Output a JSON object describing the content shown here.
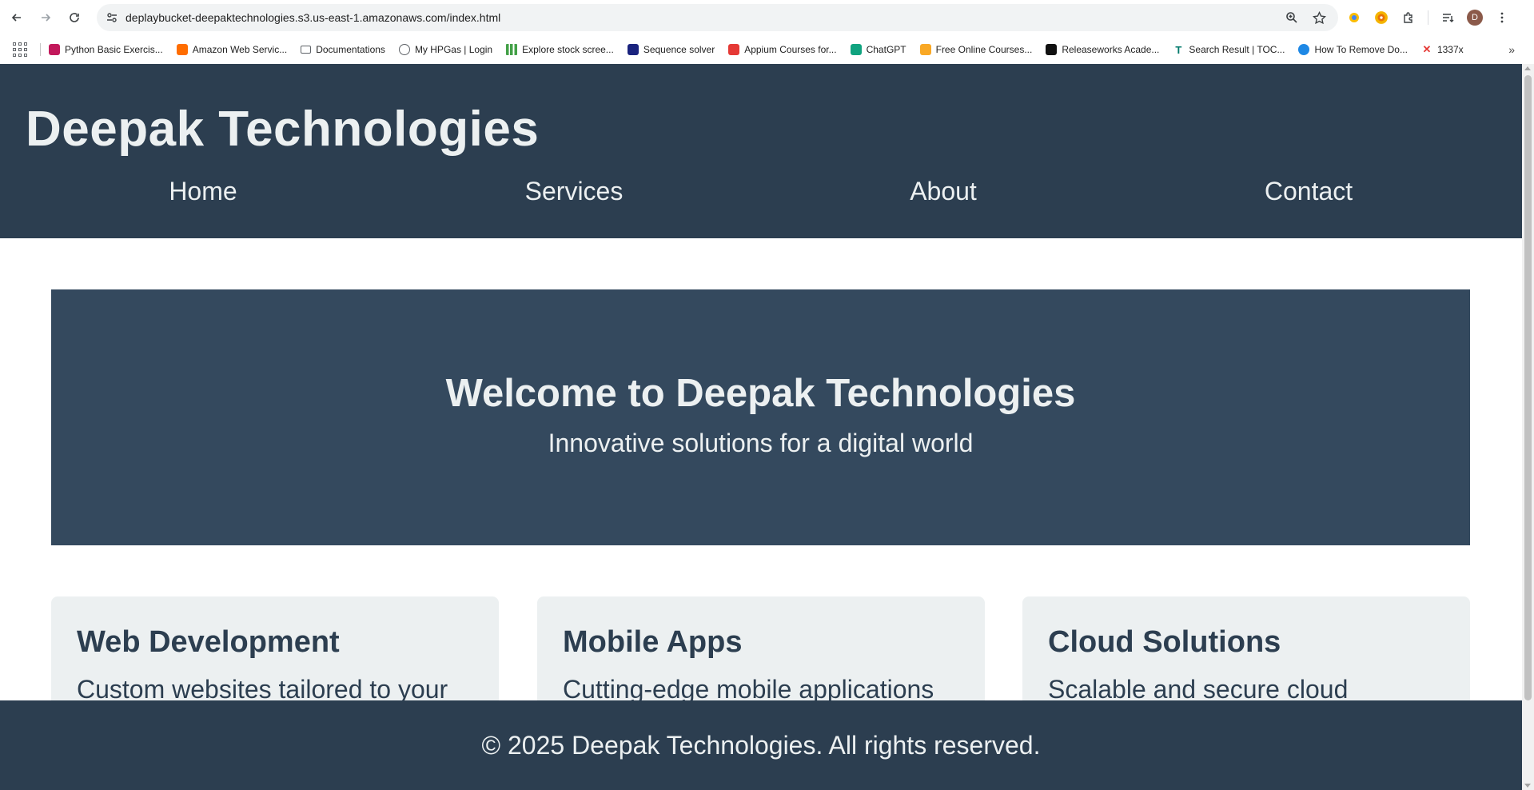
{
  "browser": {
    "url": "deplaybucket-deepaktechnologies.s3.us-east-1.amazonaws.com/index.html",
    "avatar_initial": "D",
    "bookmarks": [
      {
        "label": "Python Basic Exercis...",
        "icon": "w3resource-icon",
        "color": "#c2185b"
      },
      {
        "label": "Amazon Web Servic...",
        "icon": "aws-cube-icon",
        "color": "#ff6d00"
      },
      {
        "label": "Documentations",
        "icon": "folder-icon",
        "color": "#5f6368"
      },
      {
        "label": "My HPGas | Login",
        "icon": "globe-icon",
        "color": "#5f6368"
      },
      {
        "label": "Explore stock scree...",
        "icon": "bar-chart-icon",
        "color": "#43a047"
      },
      {
        "label": "Sequence solver",
        "icon": "sequence-solver-icon",
        "color": "#1a237e"
      },
      {
        "label": "Appium Courses for...",
        "icon": "appium-icon",
        "color": "#e53935"
      },
      {
        "label": "ChatGPT",
        "icon": "chatgpt-icon",
        "color": "#10a37f"
      },
      {
        "label": "Free Online Courses...",
        "icon": "courses-icon",
        "color": "#f9a825"
      },
      {
        "label": "Releaseworks Acade...",
        "icon": "releaseworks-icon",
        "color": "#111111"
      },
      {
        "label": "Search Result | TOC...",
        "icon": "t-letter-icon",
        "color": "#00796b"
      },
      {
        "label": "How To Remove Do...",
        "icon": "globe-color-icon",
        "color": "#1e88e5"
      },
      {
        "label": "1337x",
        "icon": "x-mark-icon",
        "color": "#e53935"
      }
    ]
  },
  "site": {
    "logo": "Deepak Technologies",
    "nav": [
      "Home",
      "Services",
      "About",
      "Contact"
    ],
    "hero": {
      "title": "Welcome to Deepak Technologies",
      "subtitle": "Innovative solutions for a digital world"
    },
    "cards": [
      {
        "title": "Web Development",
        "text": "Custom websites tailored to your"
      },
      {
        "title": "Mobile Apps",
        "text": "Cutting-edge mobile applications"
      },
      {
        "title": "Cloud Solutions",
        "text": "Scalable and secure cloud"
      }
    ],
    "footer": "© 2025 Deepak Technologies. All rights reserved."
  },
  "colors": {
    "header_bg": "#2c3e50",
    "hero_bg": "#34495e",
    "card_bg": "#ecf0f1",
    "text_light": "#ecf0f1"
  }
}
